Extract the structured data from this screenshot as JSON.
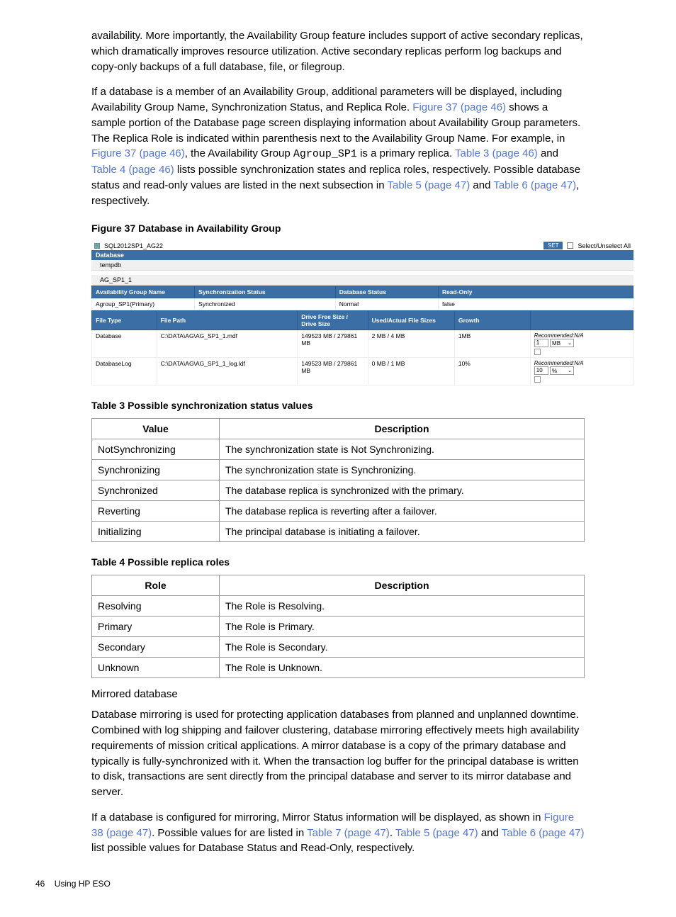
{
  "para1": "availability. More importantly, the Availability Group feature includes support of active secondary replicas, which dramatically improves resource utilization. Active secondary replicas perform log backups and copy-only backups of a full database, file, or filegroup.",
  "para2_parts": {
    "t1": "If a database is a member of an Availability Group, additional parameters will be displayed, including Availability Group Name, Synchronization Status, and Replica Role. ",
    "l1": "Figure 37 (page 46)",
    "t2": " shows a sample portion of the Database page screen displaying information about Availability Group parameters. The Replica Role is indicated within parenthesis next to the Availability Group Name. For example, in ",
    "l2": "Figure 37 (page 46)",
    "t3": ", the Availability Group ",
    "mono": "Agroup_SP1",
    "t4": " is a primary replica. ",
    "l3": "Table 3 (page 46)",
    "t5": " and ",
    "l4": "Table 4 (page 46)",
    "t6": " lists possible synchronization states and replica roles, respectively. Possible database status and read-only values are listed in the next subsection in ",
    "l5": "Table 5 (page 47)",
    "t7": " and ",
    "l6": "Table 6 (page 47)",
    "t8": ", respectively."
  },
  "fig37_caption": "Figure 37 Database in Availability Group",
  "fig": {
    "topbar": {
      "title": "SQL2012SP1_AG22",
      "set": "SET",
      "select_all": "Select/Unselect All"
    },
    "db_hdr": "Database",
    "db_row": "tempdb",
    "ag_row": "AG_SP1_1",
    "hdr1": [
      "Availability Group Name",
      "Synchronization Status",
      "Database Status",
      "Read-Only"
    ],
    "row1": [
      "Agroup_SP1(Primary)",
      "Synchronized",
      "Normal",
      "false"
    ],
    "hdr2": [
      "File Type",
      "File Path",
      "Drive Free Size / Drive Size",
      "Used/Actual File Sizes",
      "Growth",
      ""
    ],
    "row2a": [
      "Database",
      "C:\\DATA\\AG\\AG_SP1_1.mdf",
      "149523 MB / 279861 MB",
      "2 MB / 4 MB",
      "1MB"
    ],
    "row2b": [
      "DatabaseLog",
      "C:\\DATA\\AG\\AG_SP1_1_log.ldf",
      "149523 MB / 279861 MB",
      "0 MB / 1 MB",
      "10%"
    ],
    "rec": "Recommended:N/A",
    "rec_v1": "1",
    "rec_u1": "MB",
    "rec_v2": "10",
    "rec_u2": "%"
  },
  "table3_caption": "Table 3 Possible synchronization status values",
  "table3": {
    "headers": {
      "c1": "Value",
      "c2": "Description"
    },
    "rows": [
      {
        "c1": "NotSynchronizing",
        "c2": "The synchronization state is Not Synchronizing."
      },
      {
        "c1": "Synchronizing",
        "c2": "The synchronization state is Synchronizing."
      },
      {
        "c1": "Synchronized",
        "c2": "The database replica is synchronized with the primary."
      },
      {
        "c1": "Reverting",
        "c2": "The database replica is reverting after a failover."
      },
      {
        "c1": "Initializing",
        "c2": "The principal database is initiating a failover."
      }
    ]
  },
  "table4_caption": "Table 4 Possible replica roles",
  "table4": {
    "headers": {
      "c1": "Role",
      "c2": "Description"
    },
    "rows": [
      {
        "c1": "Resolving",
        "c2": "The Role is Resolving."
      },
      {
        "c1": "Primary",
        "c2": "The Role is Primary."
      },
      {
        "c1": "Secondary",
        "c2": "The Role is Secondary."
      },
      {
        "c1": "Unknown",
        "c2": "The Role is Unknown."
      }
    ]
  },
  "subhead": "Mirrored database",
  "para3": "Database mirroring is used for protecting application databases from planned and unplanned downtime. Combined with log shipping and failover clustering, database mirroring effectively meets high availability requirements of mission critical applications. A mirror database is a copy of the primary database and typically is fully-synchronized with it. When the transaction log buffer for the principal database is written to disk, transactions are sent directly from the principal database and server to its mirror database and server.",
  "para4_parts": {
    "t1": "If a database is configured for mirroring, Mirror Status information will be displayed, as shown in ",
    "l1": "Figure 38 (page 47)",
    "t2": ". Possible values for are listed in ",
    "l2": "Table 7 (page 47)",
    "t3": ". ",
    "l3": "Table 5 (page 47)",
    "t4": " and ",
    "l4": "Table 6 (page 47)",
    "t5": " list possible values for Database Status and Read-Only, respectively."
  },
  "footer": {
    "page": "46",
    "label": "Using HP ESO"
  }
}
